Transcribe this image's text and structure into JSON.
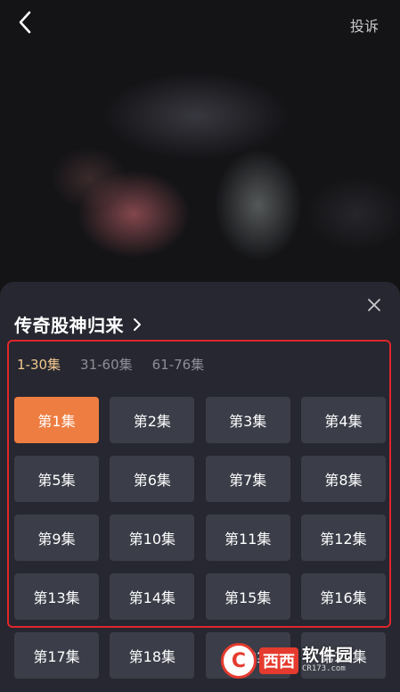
{
  "header": {
    "back_icon": "chevron-left-icon",
    "report_label": "投诉"
  },
  "sheet": {
    "title": "传奇股神归来",
    "close_icon": "close-icon",
    "range_tabs": [
      {
        "label": "1-30集",
        "active": true
      },
      {
        "label": "31-60集",
        "active": false
      },
      {
        "label": "61-76集",
        "active": false
      }
    ],
    "episodes": [
      {
        "label": "第1集",
        "active": true
      },
      {
        "label": "第2集"
      },
      {
        "label": "第3集"
      },
      {
        "label": "第4集"
      },
      {
        "label": "第5集"
      },
      {
        "label": "第6集"
      },
      {
        "label": "第7集"
      },
      {
        "label": "第8集"
      },
      {
        "label": "第9集"
      },
      {
        "label": "第10集"
      },
      {
        "label": "第11集"
      },
      {
        "label": "第12集"
      },
      {
        "label": "第13集"
      },
      {
        "label": "第14集"
      },
      {
        "label": "第15集"
      },
      {
        "label": "第16集"
      },
      {
        "label": "第17集"
      },
      {
        "label": "第18集"
      },
      {
        "label": "第19集"
      },
      {
        "label": "第20集"
      }
    ]
  },
  "watermark": {
    "logo_letter": "C",
    "brand": "西西",
    "name": "软件园",
    "url": "CR173.com"
  },
  "colors": {
    "sheet_bg": "#262730",
    "episode_bg": "#3b3d48",
    "episode_active": "#ee7d41",
    "range_active": "#f2c78f",
    "highlight_border": "#e0262b"
  }
}
